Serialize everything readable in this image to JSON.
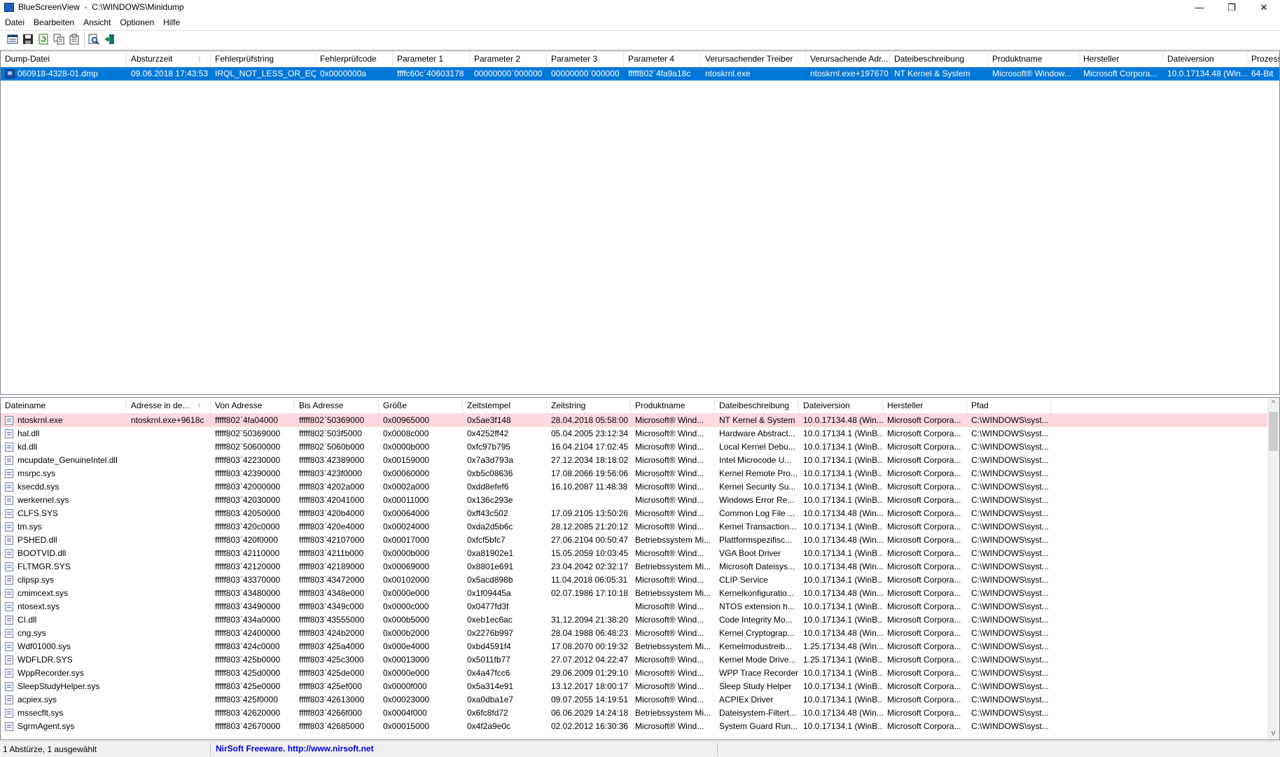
{
  "window": {
    "app_name": "BlueScreenView",
    "path": "C:\\WINDOWS\\Minidump",
    "minimize_glyph": "—",
    "restore_glyph": "❐",
    "close_glyph": "✕"
  },
  "menu": [
    "Datei",
    "Bearbeiten",
    "Ansicht",
    "Optionen",
    "Hilfe"
  ],
  "toolbar_icons": [
    "options-icon",
    "save-icon",
    "refresh-icon",
    "copy-icon",
    "properties-icon",
    "find-icon",
    "exit-icon"
  ],
  "dump_list": {
    "columns": [
      "Dump-Datei",
      "Absturzzeit",
      "Fehlerprüfstring",
      "Fehlerprüfcode",
      "Parameter 1",
      "Parameter 2",
      "Parameter 3",
      "Parameter 4",
      "Verursachender Treiber",
      "Verursachende Adr...",
      "Dateibeschreibung",
      "Produktname",
      "Hersteller",
      "Dateiversion",
      "Prozess"
    ],
    "sort_indicator": "↑",
    "rows": [
      [
        "060918-4328-01.dmp",
        "09.06.2018 17:43:53",
        "IRQL_NOT_LESS_OR_EQ",
        "0x0000000a",
        "ffffc60c`40603178",
        "00000000`000000",
        "00000000`000000",
        "fffff802`4fa9a18c",
        "ntoskrnl.exe",
        "ntoskrnl.exe+197670",
        "NT Kernel & System",
        "Microsoft® Window...",
        "Microsoft Corpora...",
        "10.0.17134.48 (Win...",
        "64-Bit"
      ]
    ],
    "scroll_left": "<",
    "scroll_right": ">"
  },
  "driver_list": {
    "columns": [
      "Dateiname",
      "Adresse in de...",
      "Von Adresse",
      "Bis Adresse",
      "Größe",
      "Zeitstempel",
      "Zeitstring",
      "Produktname",
      "Dateibeschreibung",
      "Dateiversion",
      "Hersteller",
      "Pfad"
    ],
    "sort_indicator": "↑",
    "rows": [
      [
        "ntoskrnl.exe",
        "ntoskrnl.exe+9618c",
        "fffff802`4fa04000",
        "fffff802`50369000",
        "0x00965000",
        "0x5ae3f148",
        "28.04.2018 05:58:00",
        "Microsoft® Wind...",
        "NT Kernel & System",
        "10.0.17134.48 (Win...",
        "Microsoft Corpora...",
        "C:\\WINDOWS\\syst..."
      ],
      [
        "hal.dll",
        "",
        "fffff802`50369000",
        "fffff802`503f5000",
        "0x0008c000",
        "0x4252ff42",
        "05.04.2005 23:12:34",
        "Microsoft® Wind...",
        "Hardware Abstract...",
        "10.0.17134.1 (WinB...",
        "Microsoft Corpora...",
        "C:\\WINDOWS\\syst..."
      ],
      [
        "kd.dll",
        "",
        "fffff802`50600000",
        "fffff802`5060b000",
        "0x0000b000",
        "0xfc97b795",
        "16.04.2104 17:02:45",
        "Microsoft® Wind...",
        "Local Kernel Debu...",
        "10.0.17134.1 (WinB...",
        "Microsoft Corpora...",
        "C:\\WINDOWS\\syst..."
      ],
      [
        "mcupdate_GenuineIntel.dll",
        "",
        "fffff803`42230000",
        "fffff803`42389000",
        "0x00159000",
        "0x7a3d793a",
        "27.12.2034 18:18:02",
        "Microsoft® Wind...",
        "Intel Microcode U...",
        "10.0.17134.1 (WinB...",
        "Microsoft Corpora...",
        "C:\\WINDOWS\\syst..."
      ],
      [
        "msrpc.sys",
        "",
        "fffff803`42390000",
        "fffff803`423f0000",
        "0x00060000",
        "0xb5c08636",
        "17.08.2066 19:56:06",
        "Microsoft® Wind...",
        "Kernel Remote Pro...",
        "10.0.17134.1 (WinB...",
        "Microsoft Corpora...",
        "C:\\WINDOWS\\syst..."
      ],
      [
        "ksecdd.sys",
        "",
        "fffff803`42000000",
        "fffff803`4202a000",
        "0x0002a000",
        "0xdd8efef6",
        "16.10.2087 11:48:38",
        "Microsoft® Wind...",
        "Kernel Security Su...",
        "10.0.17134.1 (WinB...",
        "Microsoft Corpora...",
        "C:\\WINDOWS\\syst..."
      ],
      [
        "werkernel.sys",
        "",
        "fffff803`42030000",
        "fffff803`42041000",
        "0x00011000",
        "0x136c293e",
        "",
        "Microsoft® Wind...",
        "Windows Error Re...",
        "10.0.17134.1 (WinB...",
        "Microsoft Corpora...",
        "C:\\WINDOWS\\syst..."
      ],
      [
        "CLFS.SYS",
        "",
        "fffff803`42050000",
        "fffff803`420b4000",
        "0x00064000",
        "0xff43c502",
        "17.09.2105 13:50:26",
        "Microsoft® Wind...",
        "Common Log File ...",
        "10.0.17134.48 (Win...",
        "Microsoft Corpora...",
        "C:\\WINDOWS\\syst..."
      ],
      [
        "tm.sys",
        "",
        "fffff803`420c0000",
        "fffff803`420e4000",
        "0x00024000",
        "0xda2d5b6c",
        "28.12.2085 21:20:12",
        "Microsoft® Wind...",
        "Kernel Transaction...",
        "10.0.17134.1 (WinB...",
        "Microsoft Corpora...",
        "C:\\WINDOWS\\syst..."
      ],
      [
        "PSHED.dll",
        "",
        "fffff803`420f0000",
        "fffff803`42107000",
        "0x00017000",
        "0xfcf5bfc7",
        "27.06.2104 00:50:47",
        "Betriebssystem Mi...",
        "Plattformspezifisc...",
        "10.0.17134.48 (Win...",
        "Microsoft Corpora...",
        "C:\\WINDOWS\\syst..."
      ],
      [
        "BOOTVID.dll",
        "",
        "fffff803`42110000",
        "fffff803`4211b000",
        "0x0000b000",
        "0xa81902e1",
        "15.05.2059 10:03:45",
        "Microsoft® Wind...",
        "VGA Boot Driver",
        "10.0.17134.1 (WinB...",
        "Microsoft Corpora...",
        "C:\\WINDOWS\\syst..."
      ],
      [
        "FLTMGR.SYS",
        "",
        "fffff803`42120000",
        "fffff803`42189000",
        "0x00069000",
        "0x8801e691",
        "23.04.2042 02:32:17",
        "Betriebssystem Mi...",
        "Microsoft Dateisys...",
        "10.0.17134.48 (Win...",
        "Microsoft Corpora...",
        "C:\\WINDOWS\\syst..."
      ],
      [
        "clipsp.sys",
        "",
        "fffff803`43370000",
        "fffff803`43472000",
        "0x00102000",
        "0x5acd898b",
        "11.04.2018 06:05:31",
        "Microsoft® Wind...",
        "CLIP Service",
        "10.0.17134.1 (WinB...",
        "Microsoft Corpora...",
        "C:\\WINDOWS\\syst..."
      ],
      [
        "cmimcext.sys",
        "",
        "fffff803`43480000",
        "fffff803`4348e000",
        "0x0000e000",
        "0x1f09445a",
        "02.07.1986 17:10:18",
        "Betriebssystem Mi...",
        "Kernelkonfiguratio...",
        "10.0.17134.48 (Win...",
        "Microsoft Corpora...",
        "C:\\WINDOWS\\syst..."
      ],
      [
        "ntosext.sys",
        "",
        "fffff803`43490000",
        "fffff803`4349c000",
        "0x0000c000",
        "0x0477fd3f",
        "",
        "Microsoft® Wind...",
        "NTOS extension h...",
        "10.0.17134.1 (WinB...",
        "Microsoft Corpora...",
        "C:\\WINDOWS\\syst..."
      ],
      [
        "CI.dll",
        "",
        "fffff803`434a0000",
        "fffff803`43555000",
        "0x000b5000",
        "0xeb1ec6ac",
        "31.12.2094 21:38:20",
        "Microsoft® Wind...",
        "Code Integrity Mo...",
        "10.0.17134.1 (WinB...",
        "Microsoft Corpora...",
        "C:\\WINDOWS\\syst..."
      ],
      [
        "cng.sys",
        "",
        "fffff803`42400000",
        "fffff803`424b2000",
        "0x000b2000",
        "0x2276b997",
        "28.04.1988 06:48:23",
        "Microsoft® Wind...",
        "Kernel Cryptograp...",
        "10.0.17134.48 (Win...",
        "Microsoft Corpora...",
        "C:\\WINDOWS\\syst..."
      ],
      [
        "Wdf01000.sys",
        "",
        "fffff803`424c0000",
        "fffff803`425a4000",
        "0x000e4000",
        "0xbd4591f4",
        "17.08.2070 00:19:32",
        "Betriebssystem Mi...",
        "Kernelmodustreib...",
        "1.25.17134.48 (Win...",
        "Microsoft Corpora...",
        "C:\\WINDOWS\\syst..."
      ],
      [
        "WDFLDR.SYS",
        "",
        "fffff803`425b0000",
        "fffff803`425c3000",
        "0x00013000",
        "0x5011fb77",
        "27.07.2012 04:22:47",
        "Microsoft® Wind...",
        "Kernel Mode Drive...",
        "1.25.17134.1 (WinB...",
        "Microsoft Corpora...",
        "C:\\WINDOWS\\syst..."
      ],
      [
        "WppRecorder.sys",
        "",
        "fffff803`425d0000",
        "fffff803`425de000",
        "0x0000e000",
        "0x4a47fcc6",
        "29.06.2009 01:29:10",
        "Microsoft® Wind...",
        "WPP Trace Recorder",
        "10.0.17134.1 (WinB...",
        "Microsoft Corpora...",
        "C:\\WINDOWS\\syst..."
      ],
      [
        "SleepStudyHelper.sys",
        "",
        "fffff803`425e0000",
        "fffff803`425ef000",
        "0x0000f000",
        "0x5a314e91",
        "13.12.2017 18:00:17",
        "Microsoft® Wind...",
        "Sleep Study Helper",
        "10.0.17134.1 (WinB...",
        "Microsoft Corpora...",
        "C:\\WINDOWS\\syst..."
      ],
      [
        "acpiex.sys",
        "",
        "fffff803`425f0000",
        "fffff803`42613000",
        "0x00023000",
        "0xa0dba1e7",
        "09.07.2055 14:19:51",
        "Microsoft® Wind...",
        "ACPIEx Driver",
        "10.0.17134.1 (WinB...",
        "Microsoft Corpora...",
        "C:\\WINDOWS\\syst..."
      ],
      [
        "mssecflt.sys",
        "",
        "fffff803`42620000",
        "fffff803`4266f000",
        "0x0004f000",
        "0x6fc8fd72",
        "06.06.2029 14:24:18",
        "Betriebssystem Mi...",
        "Dateisystem-Filtert...",
        "10.0.17134.48 (Win...",
        "Microsoft Corpora...",
        "C:\\WINDOWS\\syst..."
      ],
      [
        "SgrmAgent.sys",
        "",
        "fffff803`42670000",
        "fffff803`42685000",
        "0x00015000",
        "0x4f2a9e0c",
        "02.02.2012 16:30:36",
        "Microsoft® Wind...",
        "System Guard Run...",
        "10.0.17134.1 (WinB...",
        "Microsoft Corpora...",
        "C:\\WINDOWS\\syst..."
      ]
    ],
    "scroll_up": "^",
    "scroll_down": "v"
  },
  "status": {
    "selection": "1 Abstürze, 1 ausgewählt",
    "link": "NirSoft Freeware.  http://www.nirsoft.net"
  },
  "colors": {
    "selection": "#0078d7",
    "highlight_row": "#ffd9df",
    "link": "#0000ee"
  }
}
